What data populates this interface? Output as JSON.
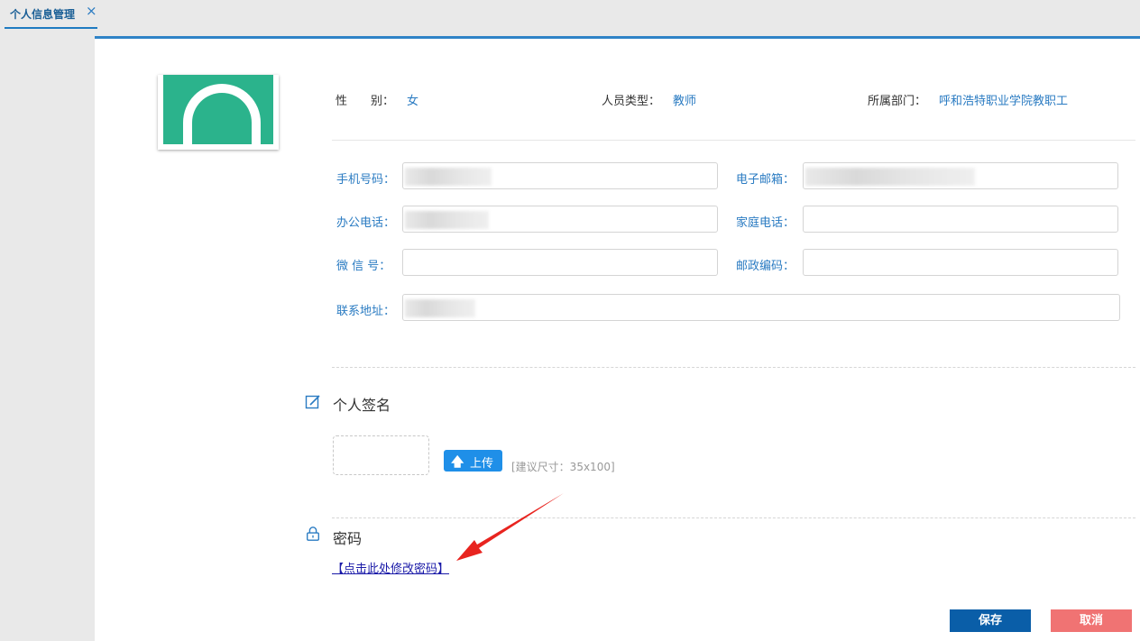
{
  "tab": {
    "label": "个人信息管理",
    "close_icon": "×"
  },
  "info": {
    "gender_label": "性　　别：",
    "gender_value": "女",
    "type_label": "人员类型：",
    "type_value": "教师",
    "dept_label": "所属部门：",
    "dept_value": "呼和浩特职业学院教职工"
  },
  "fields": {
    "mobile_label": "手机号码：",
    "email_label": "电子邮箱：",
    "office_phone_label": "办公电话：",
    "home_phone_label": "家庭电话：",
    "wechat_label": "微 信 号：",
    "postcode_label": "邮政编码：",
    "address_label": "联系地址："
  },
  "signature": {
    "title": "个人签名",
    "upload_label": "上传",
    "hint": "[建议尺寸：35x100]"
  },
  "password": {
    "title": "密码",
    "link": "【点击此处修改密码】"
  },
  "actions": {
    "save": "保存",
    "cancel": "取消"
  },
  "colors": {
    "accent": "#2a7bc2",
    "save": "#0a5ea8",
    "cancel": "#f07373",
    "avatar_bg": "#2bb38c",
    "upload": "#1f8fe8"
  }
}
